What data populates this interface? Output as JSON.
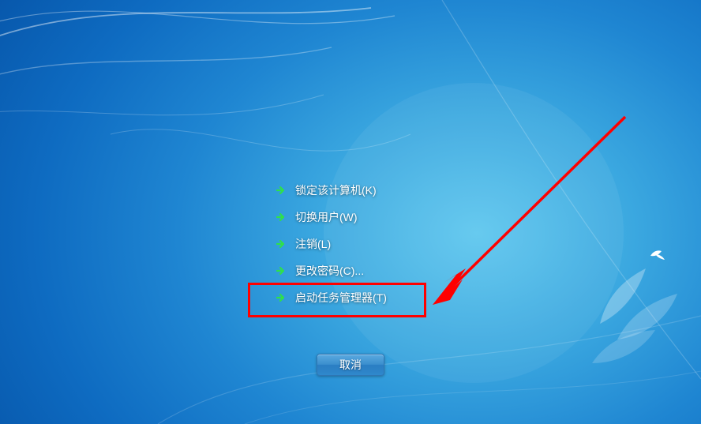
{
  "menu": {
    "items": [
      {
        "label": "锁定该计算机(K)"
      },
      {
        "label": "切换用户(W)"
      },
      {
        "label": "注销(L)"
      },
      {
        "label": "更改密码(C)..."
      },
      {
        "label": "启动任务管理器(T)"
      }
    ]
  },
  "footer": {
    "cancel_label": "取消"
  },
  "annotation": {
    "highlighted_index": 4
  },
  "colors": {
    "highlight": "#ff0000"
  }
}
